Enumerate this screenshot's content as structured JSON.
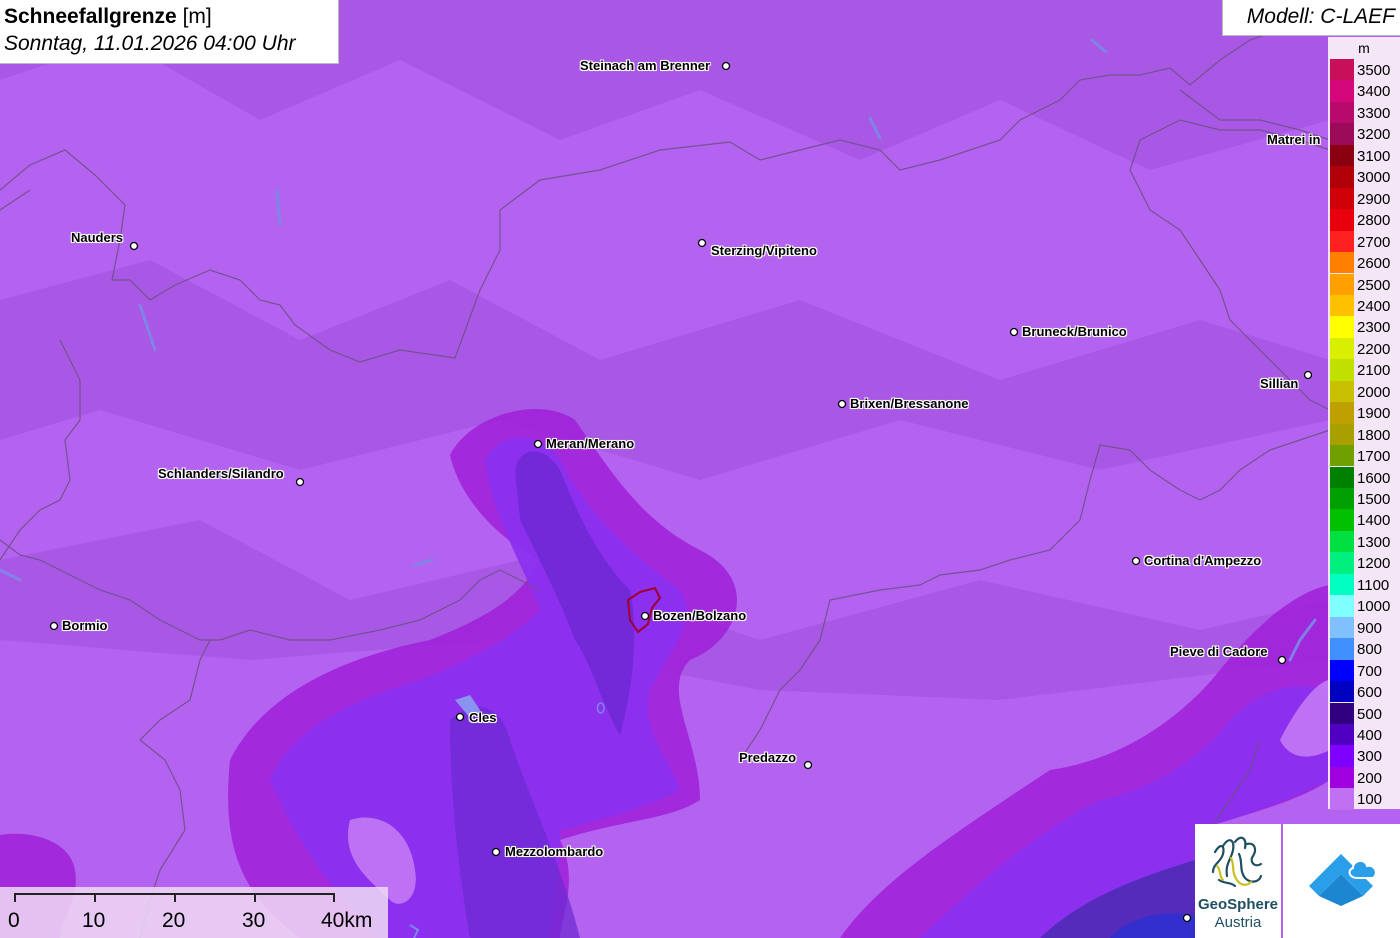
{
  "header": {
    "title_bold": "Schneefallgrenze",
    "title_unit": "[m]",
    "datetime": "Sonntag, 11.01.2026 04:00 Uhr",
    "model": "Modell: C-LAEF"
  },
  "legend": {
    "unit": "m",
    "entries": [
      {
        "label": "3500",
        "color": "#c8105a"
      },
      {
        "label": "3400",
        "color": "#d4087a"
      },
      {
        "label": "3300",
        "color": "#b80a6c"
      },
      {
        "label": "3200",
        "color": "#9c0a5a"
      },
      {
        "label": "3100",
        "color": "#8a0010"
      },
      {
        "label": "3000",
        "color": "#b00008"
      },
      {
        "label": "2900",
        "color": "#d00008"
      },
      {
        "label": "2800",
        "color": "#e8000c"
      },
      {
        "label": "2700",
        "color": "#ff2020"
      },
      {
        "label": "2600",
        "color": "#ff8000"
      },
      {
        "label": "2500",
        "color": "#ffa000"
      },
      {
        "label": "2400",
        "color": "#ffc000"
      },
      {
        "label": "2300",
        "color": "#ffff00"
      },
      {
        "label": "2200",
        "color": "#d8f000"
      },
      {
        "label": "2100",
        "color": "#c0e000"
      },
      {
        "label": "2000",
        "color": "#c8c000"
      },
      {
        "label": "1900",
        "color": "#c0a000"
      },
      {
        "label": "1800",
        "color": "#a8a000"
      },
      {
        "label": "1700",
        "color": "#70a000"
      },
      {
        "label": "1600",
        "color": "#008000"
      },
      {
        "label": "1500",
        "color": "#00a000"
      },
      {
        "label": "1400",
        "color": "#00c000"
      },
      {
        "label": "1300",
        "color": "#00e040"
      },
      {
        "label": "1200",
        "color": "#00f080"
      },
      {
        "label": "1100",
        "color": "#00ffc0"
      },
      {
        "label": "1000",
        "color": "#80ffff"
      },
      {
        "label": "900",
        "color": "#80c0ff"
      },
      {
        "label": "800",
        "color": "#4090ff"
      },
      {
        "label": "700",
        "color": "#0000ff"
      },
      {
        "label": "600",
        "color": "#0000c0"
      },
      {
        "label": "500",
        "color": "#300080"
      },
      {
        "label": "400",
        "color": "#5000c0"
      },
      {
        "label": "300",
        "color": "#8000ff"
      },
      {
        "label": "200",
        "color": "#a000e0"
      },
      {
        "label": "100",
        "color": "#c070f0"
      }
    ]
  },
  "towns": [
    {
      "name": "Steinach am Brenner"
    },
    {
      "name": "Matrei in"
    },
    {
      "name": "Nauders"
    },
    {
      "name": "Sterzing/Vipiteno"
    },
    {
      "name": "Bruneck/Brunico"
    },
    {
      "name": "Sillian"
    },
    {
      "name": "Brixen/Bressanone"
    },
    {
      "name": "Meran/Merano"
    },
    {
      "name": "Schlanders/Silandro"
    },
    {
      "name": "Cortina d'Ampezzo"
    },
    {
      "name": "Bormio"
    },
    {
      "name": "Bozen/Bolzano"
    },
    {
      "name": "Pieve di Cadore"
    },
    {
      "name": "Cles"
    },
    {
      "name": "Predazzo"
    },
    {
      "name": "Mezzolombardo"
    }
  ],
  "scale": {
    "labels": [
      "0",
      "10",
      "20",
      "30",
      "40km"
    ]
  },
  "logos": {
    "geosphere_line1": "GeoSphere",
    "geosphere_line2": "Austria"
  }
}
